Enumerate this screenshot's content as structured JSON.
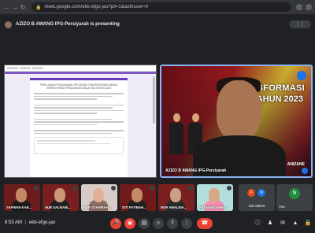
{
  "browser": {
    "url": "meet.google.com/ekb-efgo-jao?pli=1&authuser=0"
  },
  "presenting": {
    "text": "AZIZO B AWANG IPG-Persiyarah is presenting"
  },
  "shared_screen": {
    "form_title": "PERLUASAN PEMAHAMAN PROGRAM TRANSFORMASI MINDA KEMENTERIAN PENDIDIKAN MALAYSIA TAHUN 2023"
  },
  "presenter": {
    "banner_line1": "NSFORMASI",
    "banner_line2": "AHUN 2023",
    "name": "AZIZO B AWANG IPG-Persiyarah",
    "right_label": "ANIZANE"
  },
  "participants": [
    {
      "name": "SAPWAN KAB...",
      "bg": "#6d1b1b",
      "face": "#c48a66",
      "torso": "#1a1a1a"
    },
    {
      "name": "NUR SALWANI...",
      "bg": "#7a1f1f",
      "face": "#c99878",
      "torso": "#222"
    },
    {
      "name": "NUR SYAHIRAH...",
      "bg": "#d7ccc8",
      "face": "#e0b094",
      "torso": "#8d6e63"
    },
    {
      "name": "SITI FATIMAH...",
      "bg": "#701a1a",
      "face": "#c48a66",
      "torso": "#202020"
    },
    {
      "name": "NOR AMALINA...",
      "bg": "#7a2020",
      "face": "#caa084",
      "torso": "#2a2a2a"
    },
    {
      "name": "FATIMAHZAHRA...",
      "bg": "#b2dfdb",
      "face": "#d8a887",
      "torso": "#f48fb1"
    }
  ],
  "others": {
    "label": "118 others",
    "avatars": [
      {
        "letter": "F",
        "color": "#e64a19"
      },
      {
        "letter": "N",
        "color": "#1a73e8"
      }
    ]
  },
  "you": {
    "letter": "N",
    "label": "You"
  },
  "toolbar": {
    "time": "8:53 AM",
    "separator": "|",
    "meeting_code": "ekb-efgo-jao"
  }
}
